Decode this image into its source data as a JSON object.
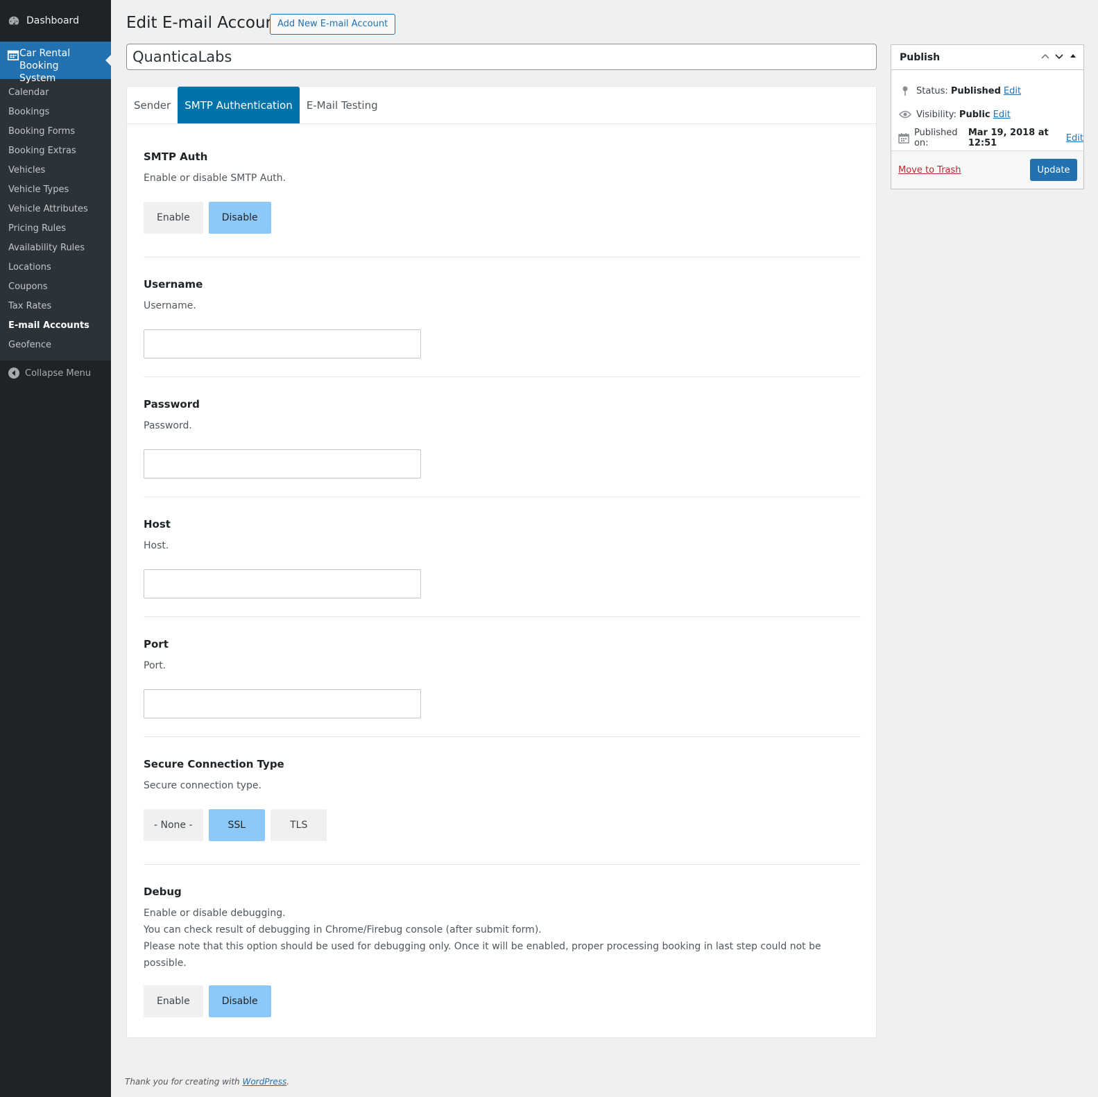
{
  "sidebar": {
    "dashboard": "Dashboard",
    "active_menu": "Car Rental Booking System",
    "items": [
      {
        "label": "Calendar"
      },
      {
        "label": "Bookings"
      },
      {
        "label": "Booking Forms"
      },
      {
        "label": "Booking Extras"
      },
      {
        "label": "Vehicles"
      },
      {
        "label": "Vehicle Types"
      },
      {
        "label": "Vehicle Attributes"
      },
      {
        "label": "Pricing Rules"
      },
      {
        "label": "Availability Rules"
      },
      {
        "label": "Locations"
      },
      {
        "label": "Coupons"
      },
      {
        "label": "Tax Rates"
      },
      {
        "label": "E-mail Accounts"
      },
      {
        "label": "Geofence"
      }
    ],
    "current_item": "E-mail Accounts",
    "collapse": "Collapse Menu"
  },
  "header": {
    "title": "Edit E-mail Account",
    "add_new": "Add New E-mail Account"
  },
  "post_title": "QuanticaLabs",
  "tabs": [
    {
      "label": "Sender"
    },
    {
      "label": "SMTP Authentication"
    },
    {
      "label": "E-Mail Testing"
    }
  ],
  "active_tab": "SMTP Authentication",
  "fields": {
    "smtp_auth": {
      "title": "SMTP Auth",
      "desc": "Enable or disable SMTP Auth.",
      "options": [
        "Enable",
        "Disable"
      ],
      "selected": "Disable"
    },
    "username": {
      "title": "Username",
      "desc": "Username.",
      "value": ""
    },
    "password": {
      "title": "Password",
      "desc": "Password.",
      "value": ""
    },
    "host": {
      "title": "Host",
      "desc": "Host.",
      "value": ""
    },
    "port": {
      "title": "Port",
      "desc": "Port.",
      "value": ""
    },
    "secure": {
      "title": "Secure Connection Type",
      "desc": "Secure connection type.",
      "options": [
        "- None -",
        "SSL",
        "TLS"
      ],
      "selected": "SSL"
    },
    "debug": {
      "title": "Debug",
      "desc1": "Enable or disable debugging.",
      "desc2": "You can check result of debugging in Chrome/Firebug console (after submit form).",
      "desc3": "Please note that this option should be used for debugging only. Once it will be enabled, proper processing booking in last step could not be possible.",
      "options": [
        "Enable",
        "Disable"
      ],
      "selected": "Disable"
    }
  },
  "publish": {
    "title": "Publish",
    "status_label": "Status:",
    "status_value": "Published",
    "visibility_label": "Visibility:",
    "visibility_value": "Public",
    "published_label": "Published on:",
    "published_value": "Mar 19, 2018 at 12:51",
    "edit": "Edit",
    "trash": "Move to Trash",
    "update": "Update"
  },
  "footer": {
    "text": "Thank you for creating with",
    "link": "WordPress",
    "end": "."
  },
  "colors": {
    "accent": "#2271b1",
    "tab_active": "#0073aa",
    "option_selected": "#8cc8f8",
    "sidebar_bg": "#1d2327"
  }
}
